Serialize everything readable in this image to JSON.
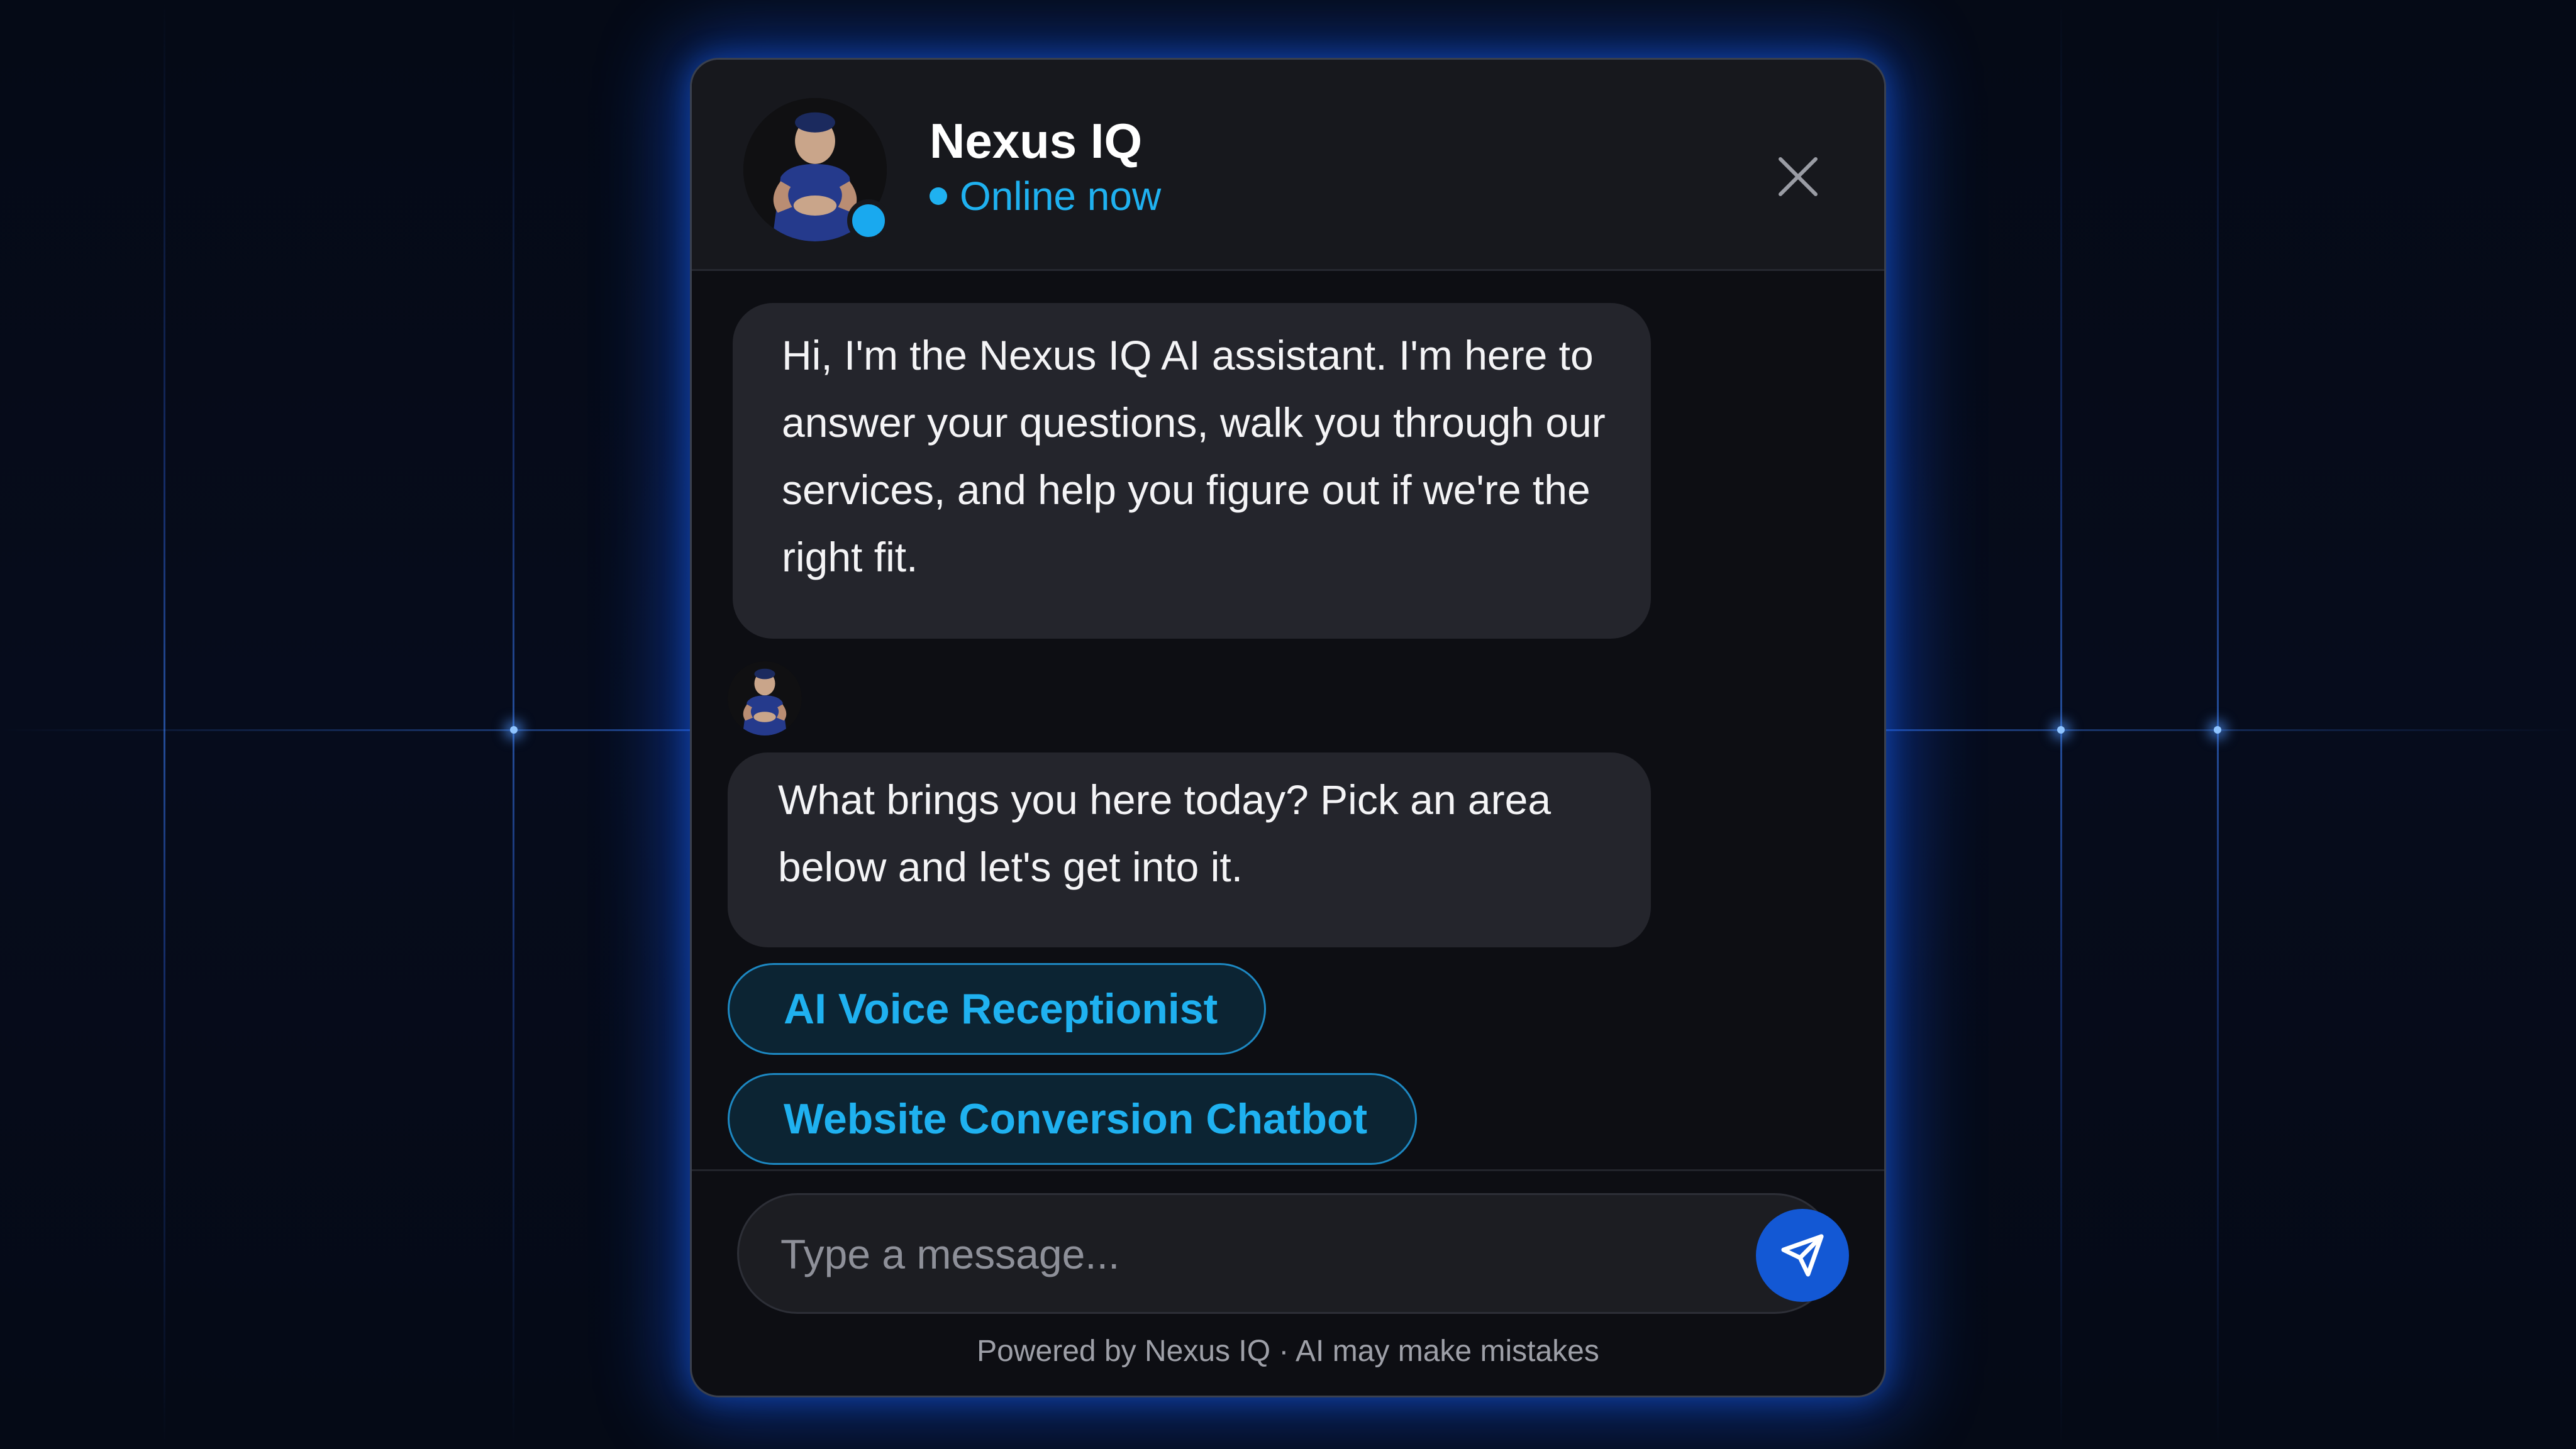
{
  "header": {
    "title": "Nexus IQ",
    "status": "Online now",
    "avatar": "agent-avatar",
    "close_icon": "close-icon"
  },
  "messages": [
    {
      "sender": "assistant",
      "text": "Hi, I'm the Nexus IQ AI assistant. I'm here to answer your questions, walk you through our services, and help you figure out if we're the right fit."
    },
    {
      "sender": "assistant",
      "text": "What brings you here today? Pick an area below and let's get into it."
    }
  ],
  "quick_replies": [
    {
      "label": "AI Voice Receptionist"
    },
    {
      "label": "Website Conversion Chatbot"
    }
  ],
  "composer": {
    "placeholder": "Type a message...",
    "value": "",
    "send_icon": "send-icon"
  },
  "footer": {
    "text": "Powered by Nexus IQ · AI may make mistakes"
  },
  "colors": {
    "accent": "#1fb1f0",
    "send_button": "#1358d4",
    "panel": "#0d0e13",
    "header": "#17181d",
    "bubble": "#24252c",
    "glow": "#1e5aff"
  }
}
